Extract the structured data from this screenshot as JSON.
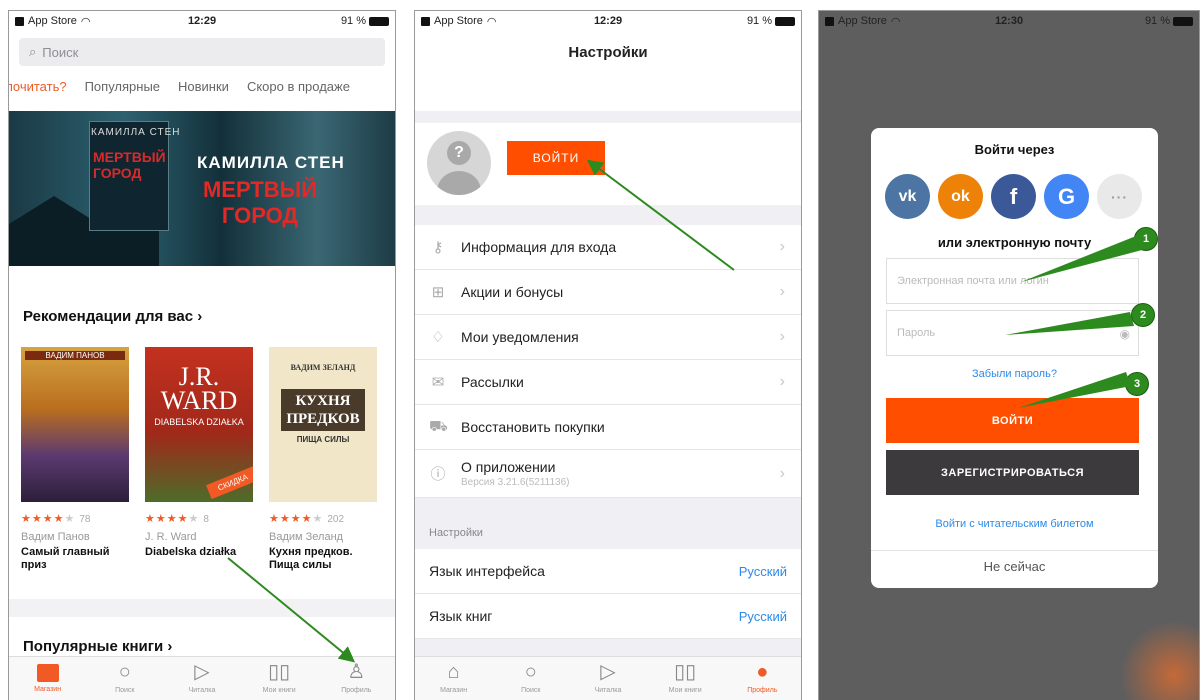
{
  "status1": {
    "carrier": "App Store",
    "time": "12:29",
    "battery": "91 %"
  },
  "status2": {
    "carrier": "App Store",
    "time": "12:29",
    "battery": "91 %"
  },
  "status3": {
    "carrier": "App Store",
    "time": "12:30",
    "battery": "91 %"
  },
  "screen1": {
    "search_placeholder": "Поиск",
    "tabs": [
      "о почитать?",
      "Популярные",
      "Новинки",
      "Скоро в продаже"
    ],
    "banner": {
      "small_author": "КАМИЛЛА СТЕН",
      "small_title": "МЕРТВЫЙ ГОРОД",
      "author": "КАМИЛЛА СТЕН",
      "title": "МЕРТВЫЙ ГОРОД"
    },
    "recommend_title": "Рекомендации для вас",
    "books": [
      {
        "cover_top": "ВАДИМ ПАНОВ",
        "rating": "★★★★",
        "rating_empty": "★",
        "count": "78",
        "author": "Вадим Панов",
        "title": "Самый главный приз"
      },
      {
        "cover_author": "J.R. WARD",
        "cover_sub": "DIABELSKA DZIAŁKA",
        "badge": "СКИДКА",
        "rating": "★★★★",
        "rating_empty": "★",
        "count": "8",
        "author": "J. R. Ward",
        "title": "Diabelska działka"
      },
      {
        "cover_author": "ВАДИМ ЗЕЛАНД",
        "cover_title": "КУХНЯ ПРЕДКОВ",
        "cover_sub": "ПИЩА СИЛЫ",
        "rating": "★★★★",
        "rating_empty": "★",
        "count": "202",
        "author": "Вадим Зеланд",
        "title": "Кухня предков. Пища силы"
      }
    ],
    "popular_title": "Популярные книги",
    "tabbar": [
      "Магазин",
      "Поиск",
      "Читалка",
      "Мои книги",
      "Профиль"
    ]
  },
  "screen2": {
    "title": "Настройки",
    "login_button": "ВОЙТИ",
    "menu": [
      {
        "label": "Информация для входа",
        "icon": "key-icon"
      },
      {
        "label": "Акции и бонусы",
        "icon": "gift-icon"
      },
      {
        "label": "Мои уведомления",
        "icon": "bell-icon"
      },
      {
        "label": "Рассылки",
        "icon": "mail-icon"
      },
      {
        "label": "Восстановить покупки",
        "icon": "cart-icon"
      },
      {
        "label": "О приложении",
        "sub": "Версия 3.21.6(5211136)",
        "icon": "info-icon"
      }
    ],
    "settings_header": "Настройки",
    "settings": [
      {
        "label": "Язык интерфейса",
        "value": "Русский"
      },
      {
        "label": "Язык книг",
        "value": "Русский"
      }
    ],
    "tabbar": [
      "Магазин",
      "Поиск",
      "Читалка",
      "Мои книги",
      "Профиль"
    ]
  },
  "screen3": {
    "title": "Войти через",
    "socials": [
      "vk",
      "ok",
      "f",
      "G",
      "···"
    ],
    "or_email": "или электронную почту",
    "email_placeholder": "Электронная почта или логин",
    "password_placeholder": "Пароль",
    "forgot": "Забыли пароль?",
    "login": "ВОЙТИ",
    "register": "ЗАРЕГИСТРИРОВАТЬСЯ",
    "ticket": "Войти с читательским билетом",
    "later": "Не сейчас",
    "steps": [
      "1",
      "2",
      "3"
    ]
  },
  "colors": {
    "accent": "#ff4e00",
    "link": "#2c8ae8",
    "annotation": "#2d8a1e"
  }
}
